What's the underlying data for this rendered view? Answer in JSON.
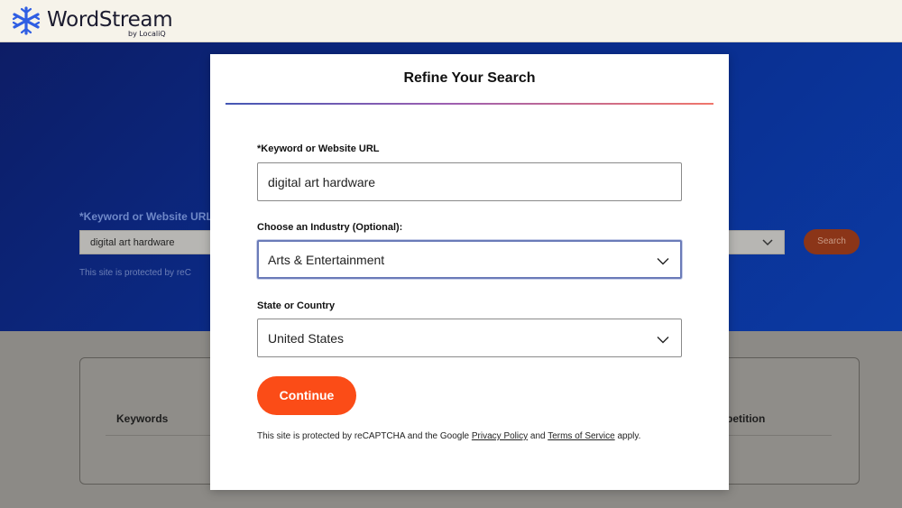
{
  "brand": {
    "name": "WordStream",
    "sub": "by LocaliQ",
    "logo_color": "#2f5ee3"
  },
  "hero": {
    "keyword_label": "*Keyword or Website URL",
    "keyword_value": "digital art hardware",
    "recaptcha_text": "This site is protected by reC",
    "search_button": "Search"
  },
  "results": {
    "columns": {
      "keywords": "Keywords",
      "competition": "petition"
    }
  },
  "modal": {
    "title": "Refine Your Search",
    "keyword_label": "*Keyword or Website URL",
    "keyword_value": "digital art hardware",
    "industry_label": "Choose an Industry (Optional):",
    "industry_value": "Arts & Entertainment",
    "location_label": "State or Country",
    "location_value": "United States",
    "continue_label": "Continue",
    "legal": {
      "prefix": "This site is protected by reCAPTCHA and the Google ",
      "privacy_link": "Privacy Policy",
      "and": " and ",
      "terms_link": "Terms of Service",
      "suffix": " apply."
    }
  },
  "colors": {
    "accent": "#fb4c17",
    "hero_blue": "#0a2e8f",
    "focus_border": "#6a7bb8"
  }
}
